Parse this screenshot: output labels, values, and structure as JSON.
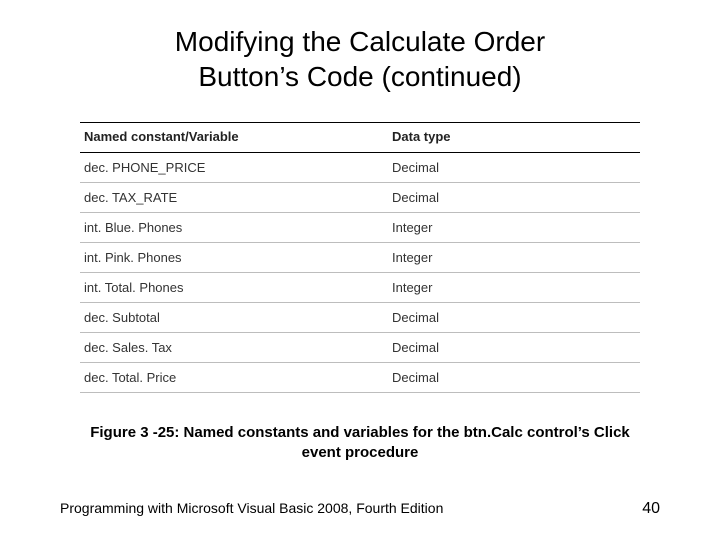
{
  "title_line1": "Modifying the Calculate Order",
  "title_line2": "Button’s Code (continued)",
  "table": {
    "head": {
      "name": "Named constant/Variable",
      "type": "Data type"
    },
    "rows": [
      {
        "name": "dec. PHONE_PRICE",
        "type": "Decimal"
      },
      {
        "name": "dec. TAX_RATE",
        "type": "Decimal"
      },
      {
        "name": "int. Blue. Phones",
        "type": "Integer"
      },
      {
        "name": "int. Pink. Phones",
        "type": "Integer"
      },
      {
        "name": "int. Total. Phones",
        "type": "Integer"
      },
      {
        "name": "dec. Subtotal",
        "type": "Decimal"
      },
      {
        "name": "dec. Sales. Tax",
        "type": "Decimal"
      },
      {
        "name": "dec. Total. Price",
        "type": "Decimal"
      }
    ]
  },
  "caption": "Figure 3 -25: Named constants and variables for the btn.Calc control’s Click event procedure",
  "footer_text": "Programming with Microsoft Visual Basic 2008, Fourth Edition",
  "page_number": "40"
}
